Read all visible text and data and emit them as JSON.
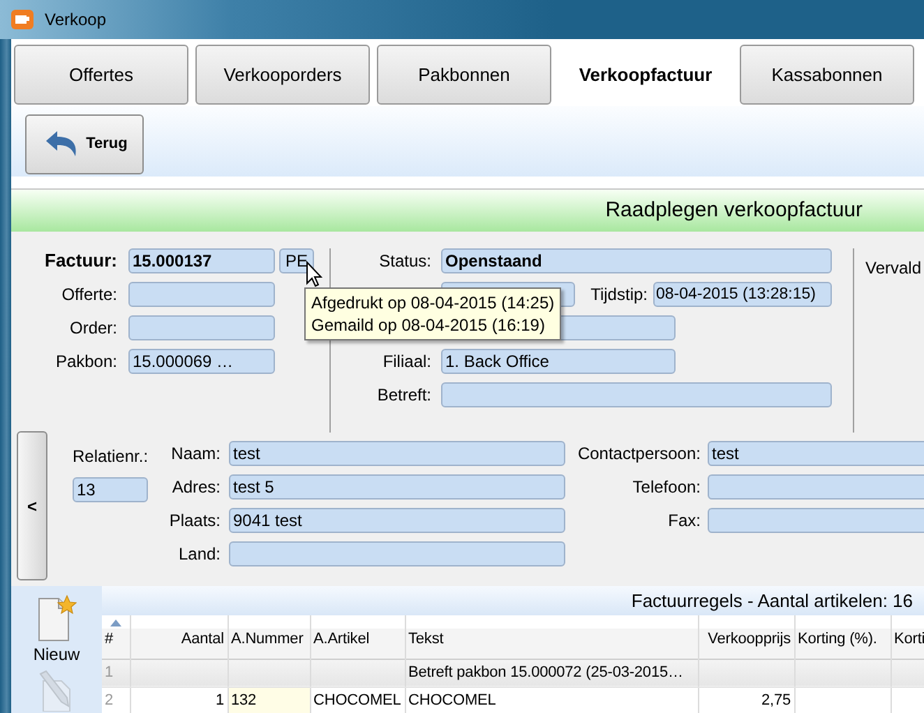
{
  "window": {
    "title": "Verkoop"
  },
  "tabs": [
    {
      "label": "Offertes",
      "selected": false
    },
    {
      "label": "Verkooporders",
      "selected": false
    },
    {
      "label": "Pakbonnen",
      "selected": false
    },
    {
      "label": "Verkoopfactuur",
      "selected": true
    },
    {
      "label": "Kassabonnen",
      "selected": false
    }
  ],
  "toolbar": {
    "back_button": "Terug"
  },
  "header": "Raadplegen verkoopfactuur",
  "invoice_fields": [
    {
      "label": "Factuur:",
      "value": "15.000137",
      "bold": true
    },
    {
      "label": "Offerte:"
    },
    {
      "label": "Order:"
    },
    {
      "label": "Pakbon:",
      "value": "15.000069 …"
    }
  ],
  "pe_button": "PE",
  "status_fields": [
    {
      "label": "Status:",
      "value": "Openstaand",
      "bold_value": true,
      "kind": "wide"
    },
    {
      "kind": "date",
      "extra_label": "Tijdstip:",
      "extra_value": "08-04-2015 (13:28:15)"
    },
    {
      "kind": "medium"
    },
    {
      "label": "Filiaal:",
      "value": "1. Back Office",
      "kind": "medium"
    },
    {
      "label": "Betreft:",
      "kind": "wide"
    }
  ],
  "right_label": "Vervald",
  "tooltip": [
    "Afgedrukt op 08-04-2015 (14:25)",
    "Gemaild op 08-04-2015 (16:19)"
  ],
  "collapse_button": "<",
  "relation": {
    "label": "Relatienr.:",
    "value": "13"
  },
  "address_fields": [
    {
      "label": "Naam:",
      "value": "test"
    },
    {
      "label": "Adres:",
      "value": "test 5"
    },
    {
      "label": "Plaats:",
      "value": "9041 test"
    },
    {
      "label": "Land:"
    }
  ],
  "contact_fields": [
    {
      "label": "Contactpersoon:",
      "value": "test"
    },
    {
      "label": "Telefoon:"
    },
    {
      "label": "Fax:"
    }
  ],
  "side_tools": [
    {
      "kind": "new",
      "label": "Nieuw"
    },
    {
      "kind": "edit"
    }
  ],
  "lines_panel": {
    "title": "Factuurregels - Aantal artikelen: 16",
    "columns": [
      {
        "label": "#",
        "kind": "text",
        "highlight": false
      },
      {
        "label": "Aantal",
        "kind": "number",
        "highlight": false
      },
      {
        "label": "A.Nummer",
        "kind": "text",
        "highlight": true
      },
      {
        "label": "A.Artikel",
        "kind": "text",
        "highlight": false
      },
      {
        "label": "Tekst",
        "kind": "text",
        "highlight": false
      },
      {
        "label": "Verkoopprijs",
        "kind": "number",
        "highlight": false
      },
      {
        "label": "Korting (%).",
        "kind": "text",
        "highlight": false
      },
      {
        "label": "Korti",
        "kind": "text",
        "highlight": false
      }
    ],
    "rows": [
      {
        "kind": "group",
        "cells": [
          "1",
          "",
          "",
          "",
          "Betreft pakbon 15.000072 (25-03-2015…",
          "",
          "",
          ""
        ]
      },
      {
        "kind": "item",
        "cells": [
          "2",
          "1",
          "132",
          "CHOCOMEL",
          "CHOCOMEL",
          "2,75",
          "",
          ""
        ]
      }
    ]
  }
}
